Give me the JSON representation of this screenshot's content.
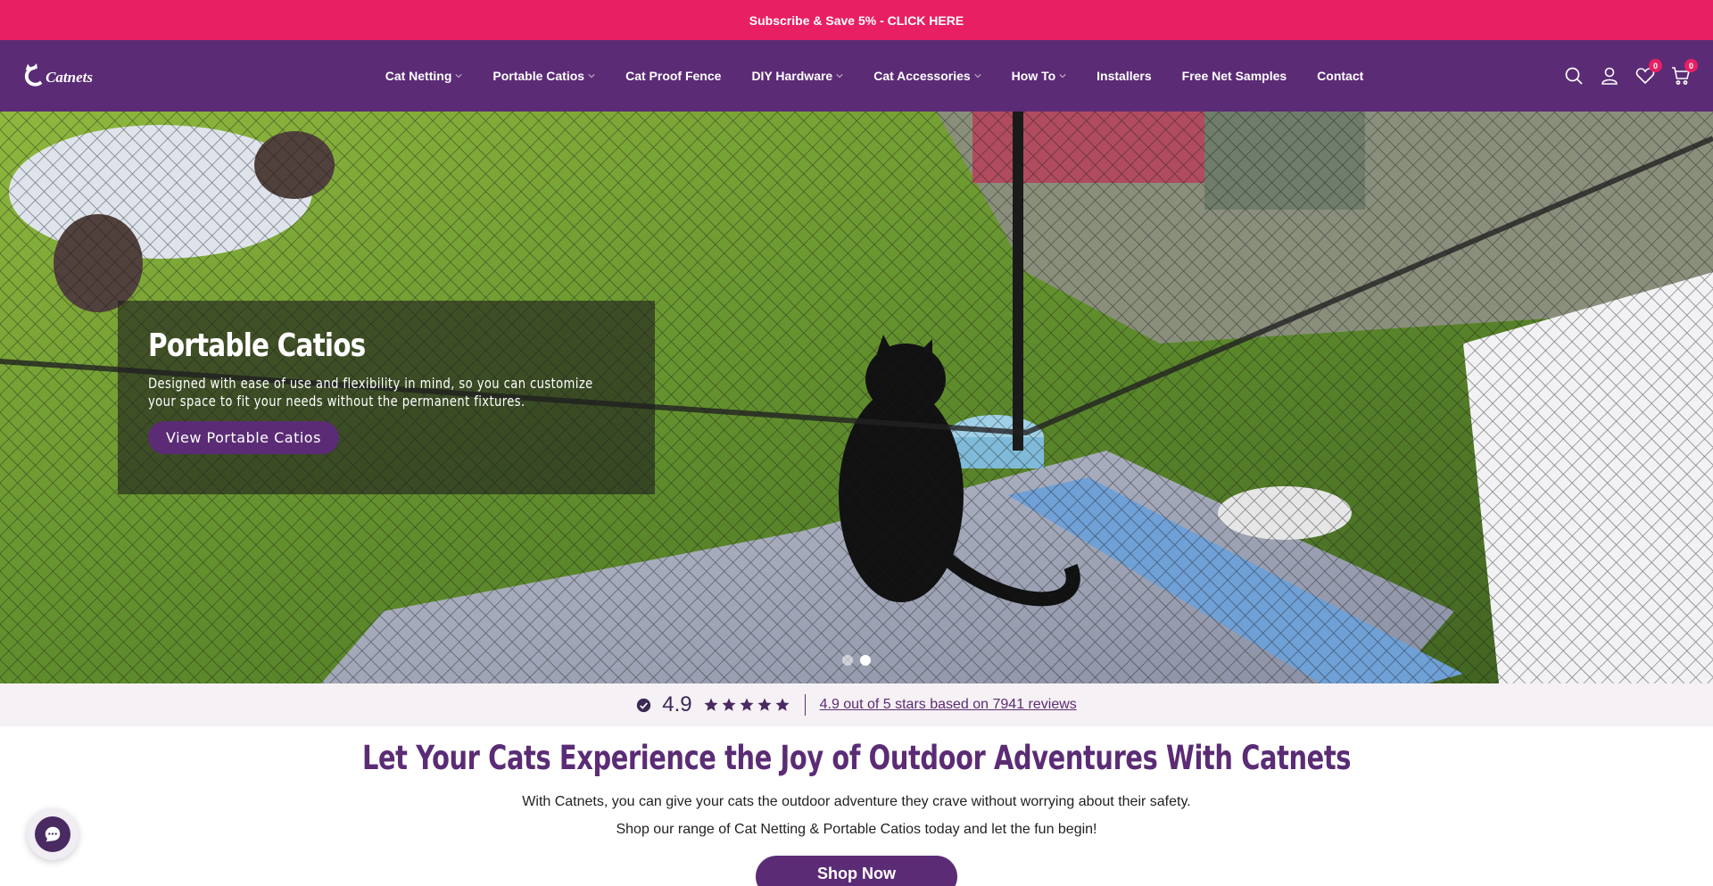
{
  "announcement": {
    "text": "Subscribe & Save 5% - CLICK HERE"
  },
  "brand": {
    "name": "Catnets"
  },
  "nav": [
    {
      "label": "Cat Netting",
      "dropdown": true
    },
    {
      "label": "Portable Catios",
      "dropdown": true
    },
    {
      "label": "Cat Proof Fence",
      "dropdown": false
    },
    {
      "label": "DIY Hardware",
      "dropdown": true
    },
    {
      "label": "Cat Accessories",
      "dropdown": true
    },
    {
      "label": "How To",
      "dropdown": true
    },
    {
      "label": "Installers",
      "dropdown": false
    },
    {
      "label": "Free Net Samples",
      "dropdown": false
    },
    {
      "label": "Contact",
      "dropdown": false
    }
  ],
  "header_icons": {
    "wishlist_count": "0",
    "cart_count": "0"
  },
  "hero": {
    "title": "Portable Catios",
    "description": "Designed with ease of use and flexibility in mind, so you can customize your space to fit your needs without the permanent fixtures.",
    "button": "View Portable Catios",
    "slides": 2,
    "active_slide": 2
  },
  "reviews": {
    "rating": "4.9",
    "stars": 5,
    "summary": "4.9 out of 5 stars based on 7941 reviews"
  },
  "content": {
    "headline": "Let Your Cats Experience the Joy of Outdoor Adventures With Catnets",
    "paragraph1": "With Catnets, you can give your cats the outdoor adventure they crave without worrying about their safety.",
    "paragraph2": "Shop our range of Cat Netting & Portable Catios today and let the fun begin!",
    "button": "Shop Now"
  },
  "colors": {
    "pink": "#e81f63",
    "purple": "#5b2c75"
  }
}
